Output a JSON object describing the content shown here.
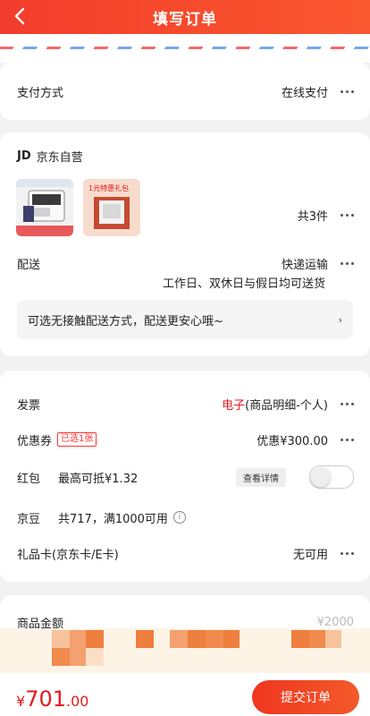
{
  "header": {
    "title": "填写订单"
  },
  "payment": {
    "label": "支付方式",
    "value": "在线支付"
  },
  "store": {
    "logo": "JD",
    "name": "京东自营",
    "count_text": "共3件",
    "thumbs": [
      {
        "banner": "",
        "caption": ""
      },
      {
        "banner": "1元特惠礼包",
        "caption": ""
      }
    ],
    "delivery_label": "配送",
    "delivery_value": "快递运输",
    "delivery_note": "工作日、双休日与假日均可送货",
    "contactless": "可选无接触配送方式，配送更安心哦~"
  },
  "invoice": {
    "label": "发票",
    "highlight": "电子",
    "detail": "(商品明细-个人)"
  },
  "coupon": {
    "label": "优惠券",
    "tag": "已选1张",
    "value": "优惠¥300.00"
  },
  "redpacket": {
    "label": "红包",
    "value": "最高可抵¥1.32",
    "button": "查看详情"
  },
  "jingdou": {
    "label": "京豆",
    "value": "共717，满1000可用"
  },
  "giftcard": {
    "label": "礼品卡(京东卡/E卡)",
    "value": "无可用"
  },
  "summary": {
    "label": "商品金额",
    "value": "¥2000"
  },
  "footer": {
    "currency": "¥",
    "amount_int": "701",
    "amount_dec": ".00",
    "submit_label": "提交订单"
  },
  "colors": {
    "brand": "#f23c2c",
    "price": "#e4191f",
    "stripe_red": "#f26a6a",
    "stripe_blue": "#7aa7ec"
  }
}
